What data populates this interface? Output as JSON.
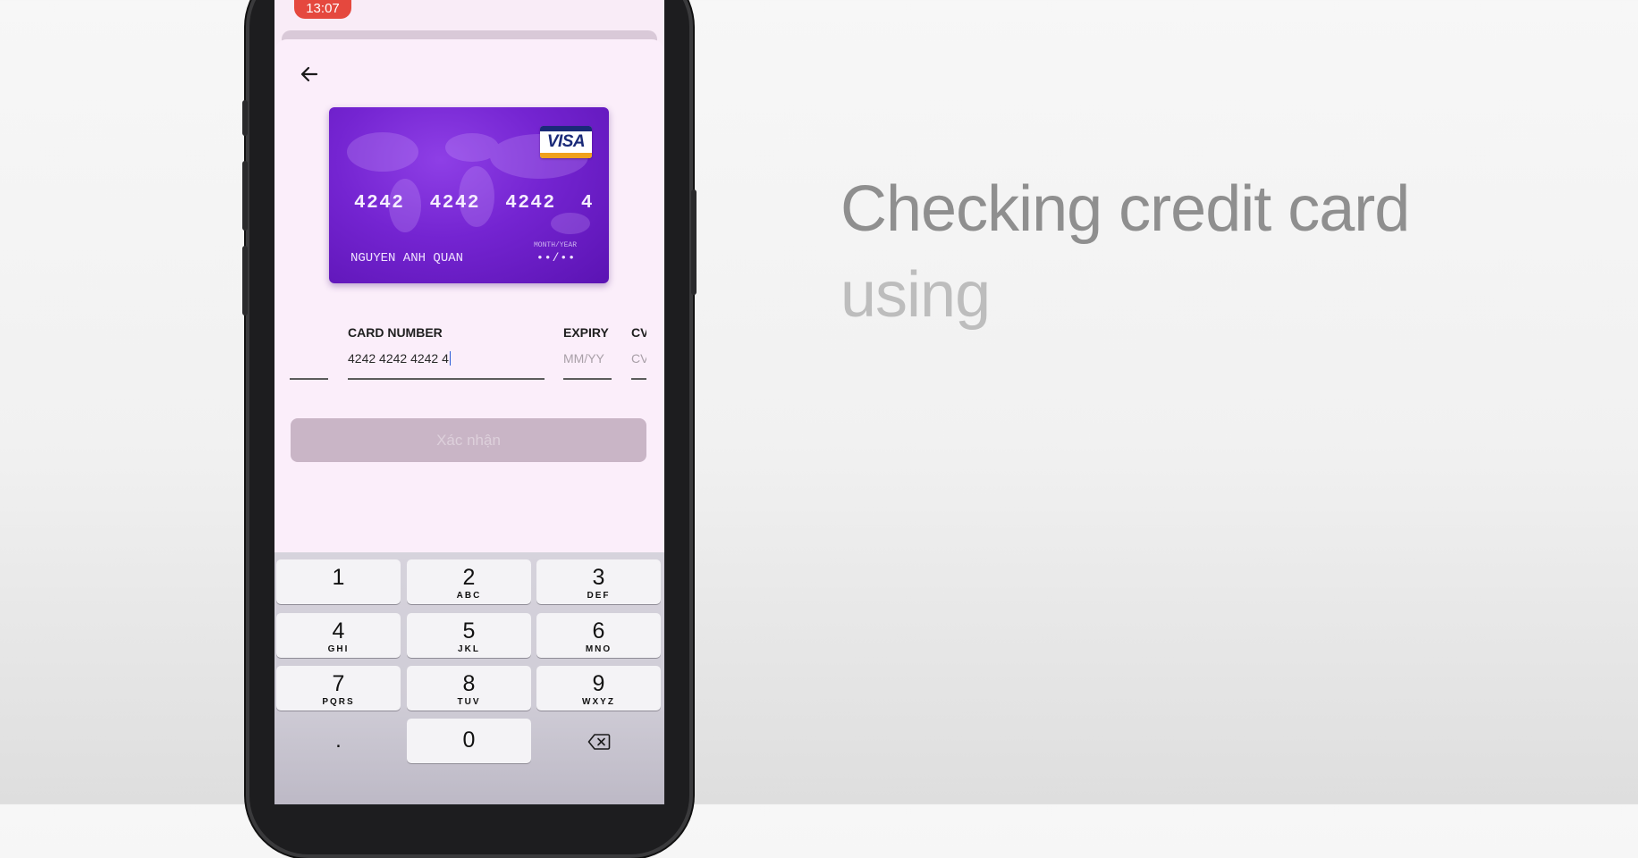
{
  "status_bar": {
    "time": "13:07"
  },
  "card_preview": {
    "brand": "VISA",
    "number": "4242  4242  4242  4",
    "holder": "NGUYEN ANH QUAN",
    "expiry_label": "MONTH/YEAR",
    "expiry_value": "••/••"
  },
  "form": {
    "card_number_label": "CARD NUMBER",
    "card_number_value": "4242 4242 4242 4",
    "expiry_label": "EXPIRY",
    "expiry_placeholder": "MM/YY",
    "cvc_label": "CV",
    "cvc_placeholder": "CV"
  },
  "confirm_button": {
    "label": "Xác nhận"
  },
  "keypad": {
    "keys": [
      {
        "num": "1",
        "letters": ""
      },
      {
        "num": "2",
        "letters": "ABC"
      },
      {
        "num": "3",
        "letters": "DEF"
      },
      {
        "num": "4",
        "letters": "GHI"
      },
      {
        "num": "5",
        "letters": "JKL"
      },
      {
        "num": "6",
        "letters": "MNO"
      },
      {
        "num": "7",
        "letters": "PQRS"
      },
      {
        "num": "8",
        "letters": "TUV"
      },
      {
        "num": "9",
        "letters": "WXYZ"
      }
    ],
    "dot": ".",
    "zero": "0"
  },
  "headline": {
    "line1": "Checking credit card",
    "line2": "using"
  },
  "icons": {
    "back": "arrow-left-icon",
    "backspace": "backspace-icon",
    "brand": "visa-logo"
  }
}
